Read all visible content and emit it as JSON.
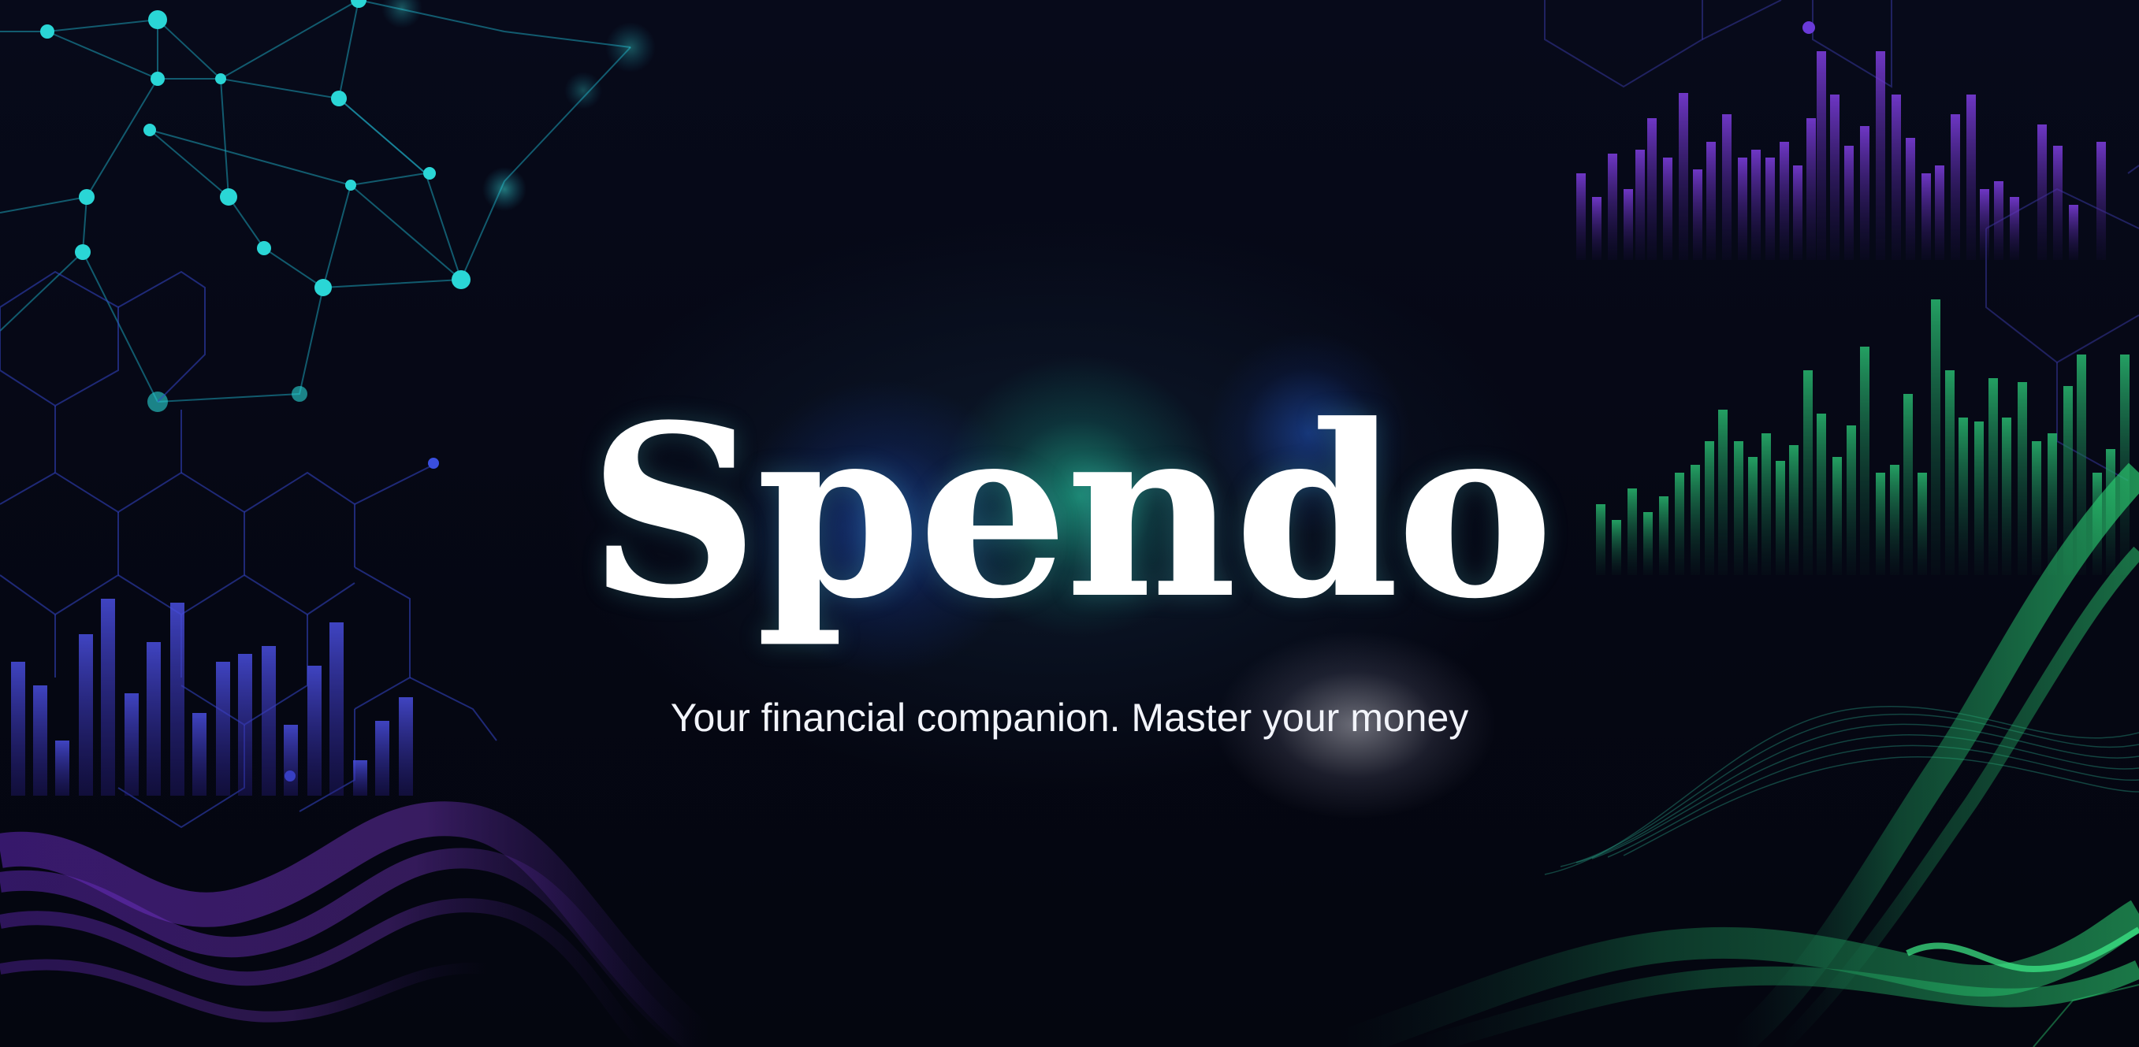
{
  "hero": {
    "title": "Spendo",
    "tagline": "Your financial companion. Master your money"
  },
  "colors": {
    "background": "#060815",
    "text": "#ffffff",
    "accent_teal": "#26dcaa",
    "accent_green": "#2fd36b",
    "accent_purple": "#7a3cd8",
    "accent_blue": "#3a4fd6"
  }
}
